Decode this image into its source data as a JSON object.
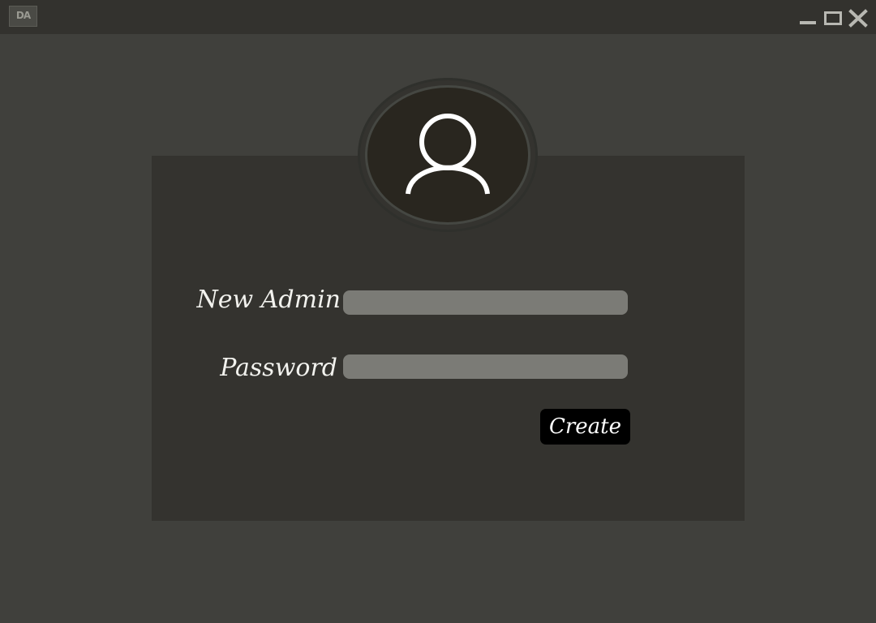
{
  "titlebar": {
    "logo_text": "DA"
  },
  "icons": {
    "window_minimize": "minimize-icon",
    "window_maximize": "maximize-icon",
    "window_close": "close-icon",
    "avatar": "user-icon"
  },
  "form": {
    "admin_label": "New Admin",
    "admin_value": "",
    "password_label": "Password",
    "password_value": "",
    "create_label": "Create"
  },
  "colors": {
    "background": "#40403c",
    "titlebar": "#33322e",
    "card": "#34332f",
    "input": "#7b7b76",
    "button": "#000000",
    "text": "#f2f2ee"
  }
}
